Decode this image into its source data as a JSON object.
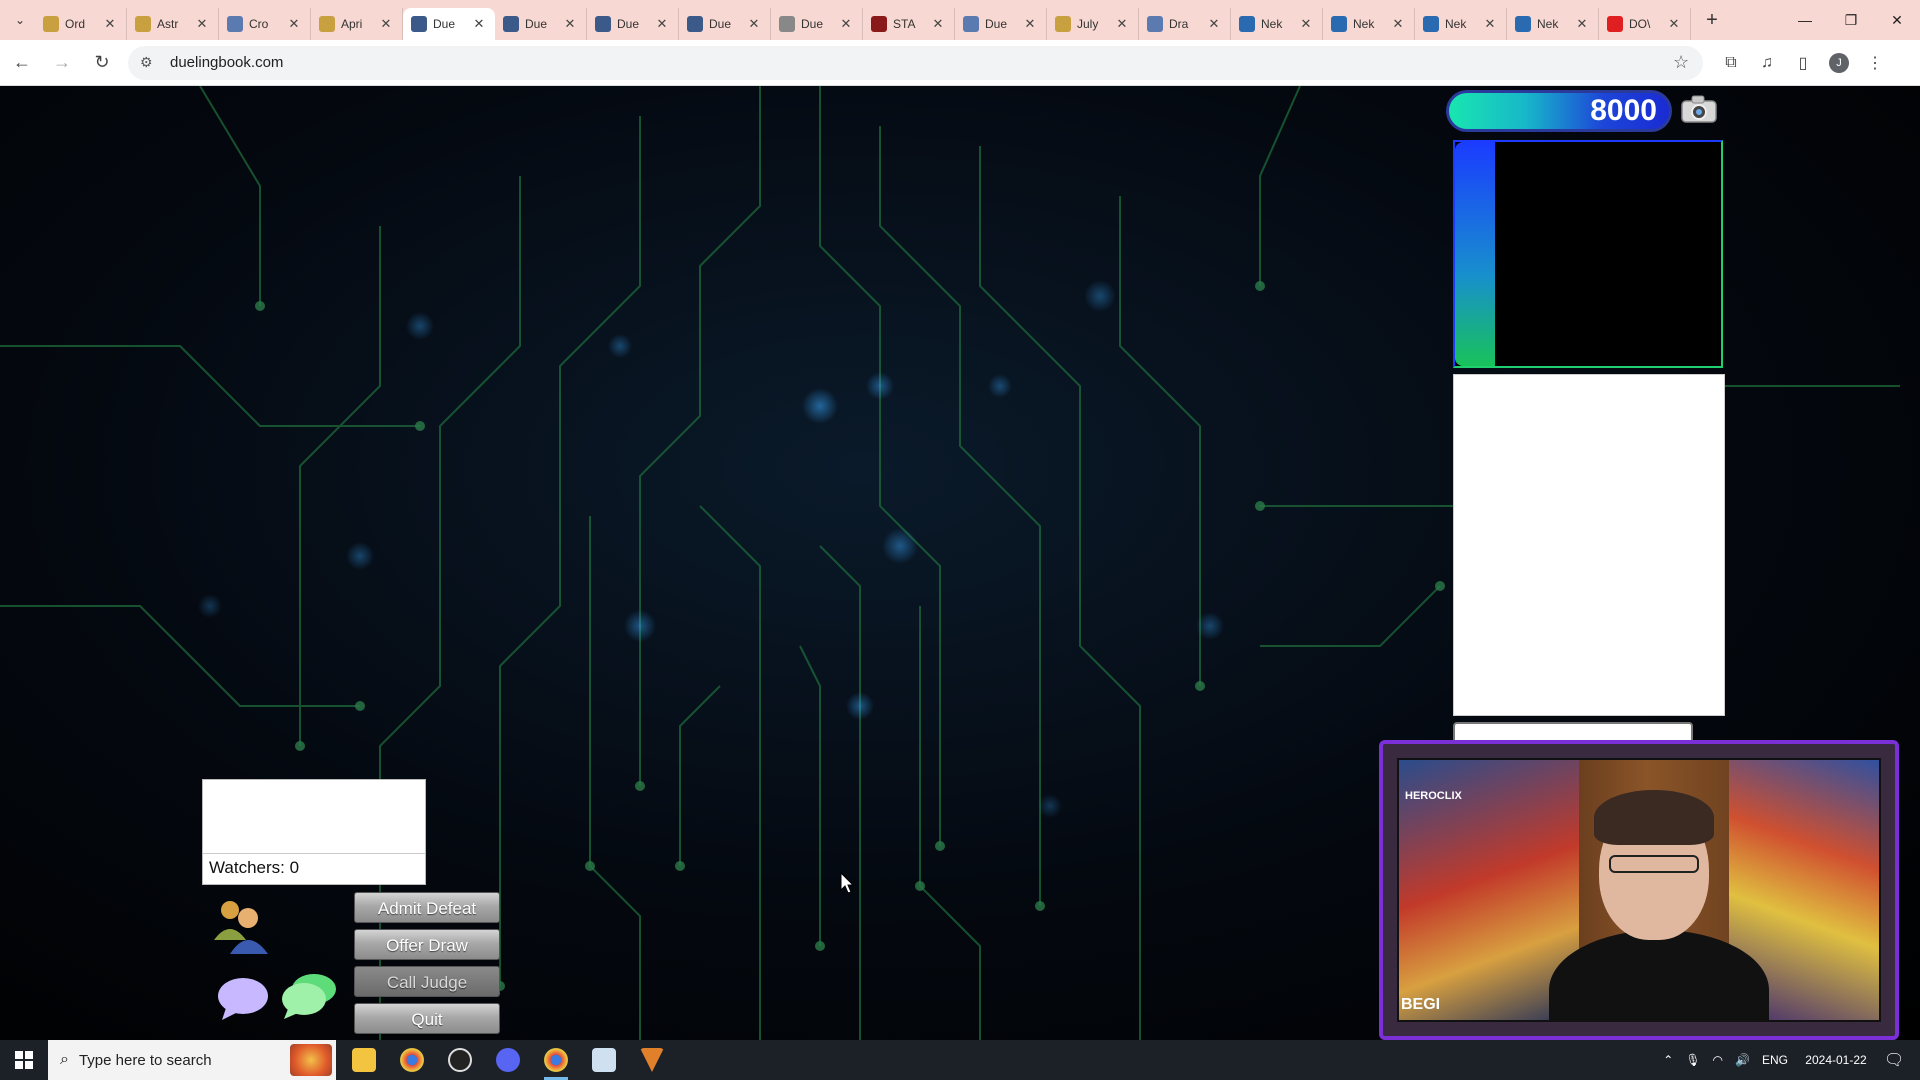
{
  "browser": {
    "tabs": [
      {
        "label": "Ord",
        "color": "#c8a040"
      },
      {
        "label": "Astr",
        "color": "#c8a040"
      },
      {
        "label": "Cro",
        "color": "#5a7ab0"
      },
      {
        "label": "Apri",
        "color": "#c8a040"
      },
      {
        "label": "Due",
        "color": "#3b5a8a",
        "active": true
      },
      {
        "label": "Due",
        "color": "#3b5a8a"
      },
      {
        "label": "Due",
        "color": "#3b5a8a"
      },
      {
        "label": "Due",
        "color": "#3b5a8a"
      },
      {
        "label": "Due",
        "color": "#888888"
      },
      {
        "label": "STA",
        "color": "#8a1a1a"
      },
      {
        "label": "Due",
        "color": "#5a7ab0"
      },
      {
        "label": "July",
        "color": "#c8a040"
      },
      {
        "label": "Dra",
        "color": "#5a7ab0"
      },
      {
        "label": "Nek",
        "color": "#2a6ab0"
      },
      {
        "label": "Nek",
        "color": "#2a6ab0"
      },
      {
        "label": "Nek",
        "color": "#2a6ab0"
      },
      {
        "label": "Nek",
        "color": "#2a6ab0"
      },
      {
        "label": "DO\\",
        "color": "#e02020"
      }
    ],
    "url": "duelingbook.com"
  },
  "game": {
    "life_points": "8000",
    "watchers_label": "Watchers: 0",
    "buttons": {
      "admit_defeat": "Admit Defeat",
      "offer_draw": "Offer Draw",
      "call_judge": "Call Judge",
      "quit": "Quit"
    }
  },
  "webcam": {
    "logo_text": "HEROCLIX",
    "bottom_text": "BEGI"
  },
  "taskbar": {
    "search_placeholder": "Type here to search",
    "tray_language": "ENG",
    "date": "2024-01-22"
  }
}
